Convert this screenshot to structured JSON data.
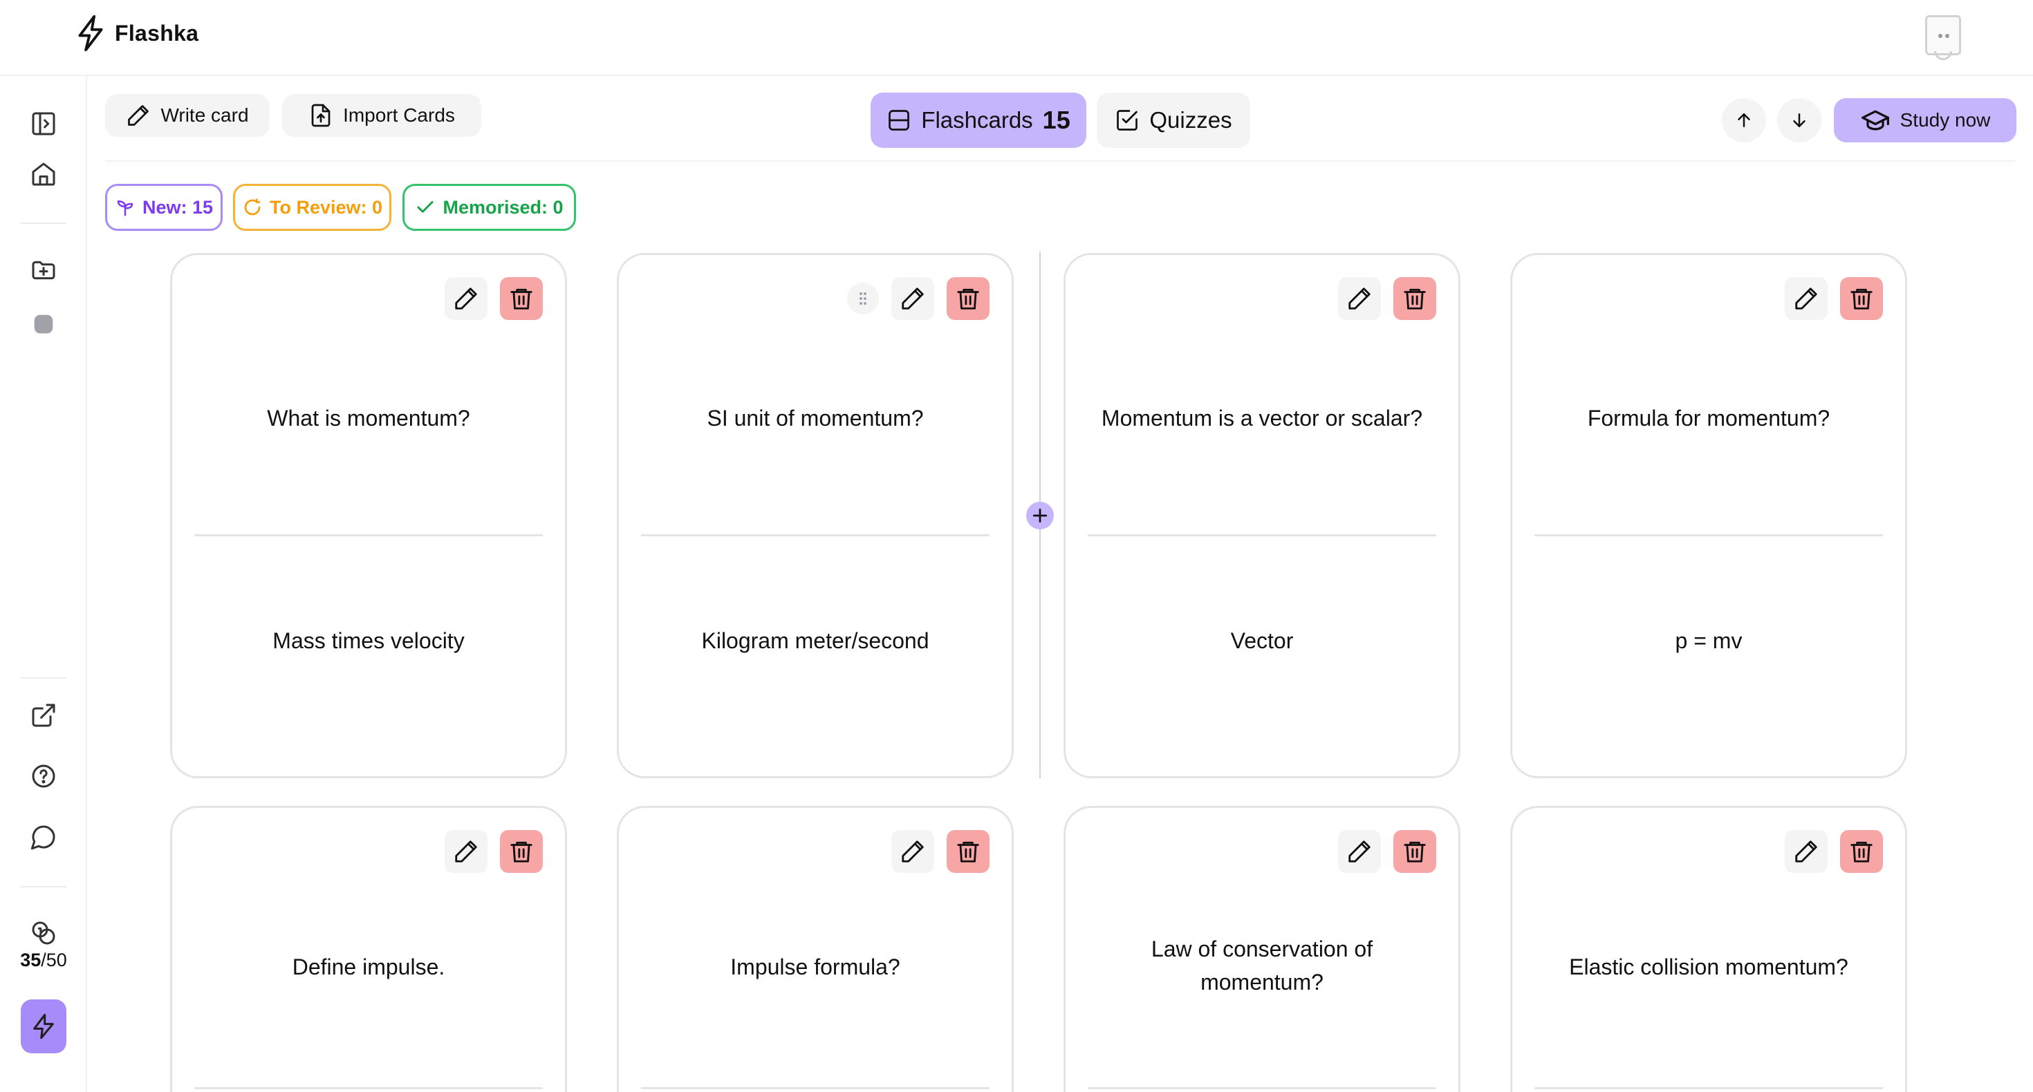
{
  "app": {
    "name": "Flashka"
  },
  "toolbar": {
    "write_label": "Write card",
    "import_label": "Import Cards",
    "flashcards_label": "Flashcards",
    "flashcards_count": "15",
    "quizzes_label": "Quizzes",
    "study_label": "Study now"
  },
  "status": {
    "new": "New: 15",
    "review": "To Review: 0",
    "memorised": "Memorised: 0"
  },
  "credits": {
    "used": "35",
    "total": "/50"
  },
  "cards": [
    {
      "question": "What is momentum?",
      "answer": "Mass times velocity"
    },
    {
      "question": "SI unit of momentum?",
      "answer": "Kilogram meter/second"
    },
    {
      "question": "Momentum is a vector or scalar?",
      "answer": "Vector"
    },
    {
      "question": "Formula for momentum?",
      "answer": "p = mv"
    },
    {
      "question": "Define impulse.",
      "answer": ""
    },
    {
      "question": "Impulse formula?",
      "answer": ""
    },
    {
      "question": "Law of conservation of momentum?",
      "answer": ""
    },
    {
      "question": "Elastic collision momentum?",
      "answer": ""
    }
  ],
  "colors": {
    "accent": "#c4b5fd",
    "accent_strong": "#a78bfa",
    "new": "#7c3aed",
    "review": "#f59e0b",
    "memorised": "#16a34a",
    "delete": "#f8a5a5"
  },
  "icons": {
    "brand": "bolt-icon",
    "sidebar": [
      "sidebar-toggle-icon",
      "home-icon",
      "folder-plus-icon",
      "folder-dot-icon",
      "external-link-icon",
      "help-circle-icon",
      "chat-icon",
      "coins-icon",
      "bolt-icon"
    ],
    "card_actions": [
      "grip-icon",
      "pencil-icon",
      "trash-icon"
    ]
  }
}
